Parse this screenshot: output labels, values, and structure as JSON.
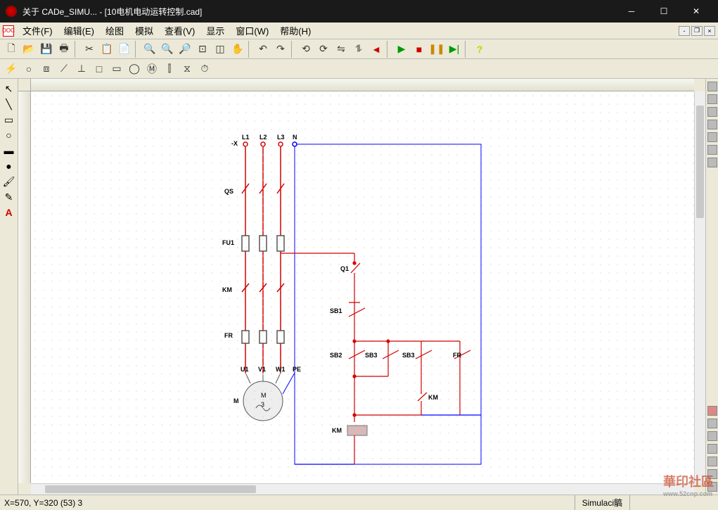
{
  "window": {
    "title": "关于 CADe_SIMU... - [10电机电动运转控制.cad]"
  },
  "menu": {
    "file": "文件(F)",
    "edit": "编辑(E)",
    "draw": "绘图",
    "simulate": "模拟",
    "view": "查看(V)",
    "display": "显示",
    "window": "窗口(W)",
    "help": "帮助(H)"
  },
  "status": {
    "coord": "X=570, Y=320 (53) 3",
    "sim": "Simulaci髇"
  },
  "labels": {
    "x": "-X",
    "L1": "L1",
    "L2": "L2",
    "L3": "L3",
    "N": "N",
    "QS": "QS",
    "FU1": "FU1",
    "KM": "KM",
    "FR": "FR",
    "U1": "U1",
    "V1": "V1",
    "W1": "W1",
    "PE": "PE",
    "M": "M",
    "M3": "3",
    "Q1": "Q1",
    "SB1": "SB1",
    "SB2": "SB2",
    "SB3": "SB3",
    "KMc": "KM",
    "FRc": "FR"
  },
  "watermark": {
    "main": "華印社區",
    "sub": "www.52cnp.com"
  }
}
